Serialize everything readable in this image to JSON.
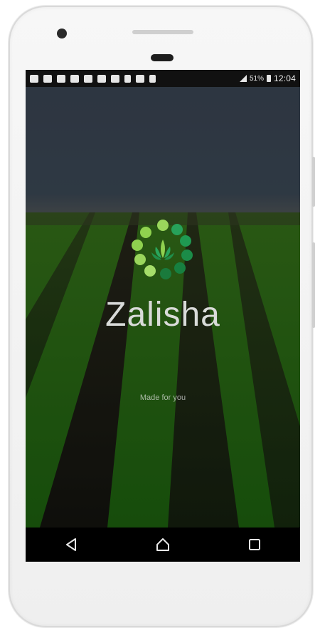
{
  "app": {
    "title": "Zalisha",
    "tagline": "Made for you"
  },
  "status_bar": {
    "battery": "51%",
    "time": "12:04",
    "notification_icons": [
      "facebook-icon",
      "message-icon",
      "image-icon",
      "window-icon",
      "mail-icon",
      "twitter-icon",
      "voicemail-icon",
      "sim1-icon",
      "no-signal-icon",
      "sim2-icon"
    ]
  },
  "navigation": {
    "back": "back-icon",
    "home": "home-icon",
    "recents": "recents-icon"
  },
  "colors": {
    "logo_light": "#8fd14f",
    "logo_dark": "#1f8f4a",
    "title_text": "#d9dbd9"
  }
}
